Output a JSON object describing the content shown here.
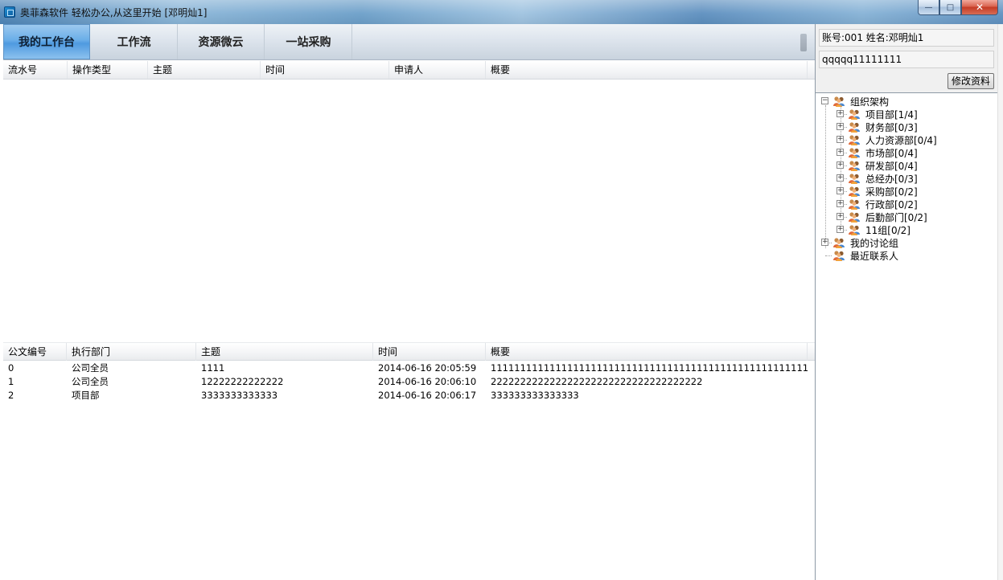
{
  "window": {
    "title": "奥菲森软件  轻松办公,从这里开始 [邓明灿1]",
    "buttons": {
      "minimize": "—",
      "maximize": "□",
      "close": "✕"
    }
  },
  "nav": {
    "tabs": [
      {
        "label": "我的工作台",
        "active": true
      },
      {
        "label": "工作流",
        "active": false
      },
      {
        "label": "资源微云",
        "active": false
      },
      {
        "label": "一站采购",
        "active": false
      }
    ]
  },
  "tasks": {
    "columns": [
      "流水号",
      "操作类型",
      "主题",
      "时间",
      "申请人",
      "概要"
    ],
    "rows": []
  },
  "docs": {
    "columns": [
      "公文编号",
      "执行部门",
      "主题",
      "时间",
      "概要"
    ],
    "rows": [
      [
        "0",
        "公司全员",
        "1111",
        "2014-06-16 20:05:59",
        "11111111111111111111111111111111111111111111111111111111111"
      ],
      [
        "1",
        "公司全员",
        "12222222222222",
        "2014-06-16 20:06:10",
        "222222222222222222222222222222222222"
      ],
      [
        "2",
        "项目部",
        "3333333333333",
        "2014-06-16 20:06:17",
        "333333333333333"
      ]
    ]
  },
  "profile": {
    "account_line": "账号:001   姓名:邓明灿1",
    "signature": "qqqqq11111111",
    "edit_button": "修改资料"
  },
  "tree": {
    "root": "组织架构",
    "departments": [
      "项目部[1/4]",
      "财务部[0/3]",
      "人力资源部[0/4]",
      "市场部[0/4]",
      "研发部[0/4]",
      "总经办[0/3]",
      "采购部[0/2]",
      "行政部[0/2]",
      "后勤部门[0/2]",
      "11组[0/2]"
    ],
    "discussion": "我的讨论组",
    "recent": "最近联系人"
  },
  "colors": {
    "active_tab": "#6aaee8",
    "navbar": "#dfe6ee",
    "titlebar": "#6c9fc9"
  }
}
